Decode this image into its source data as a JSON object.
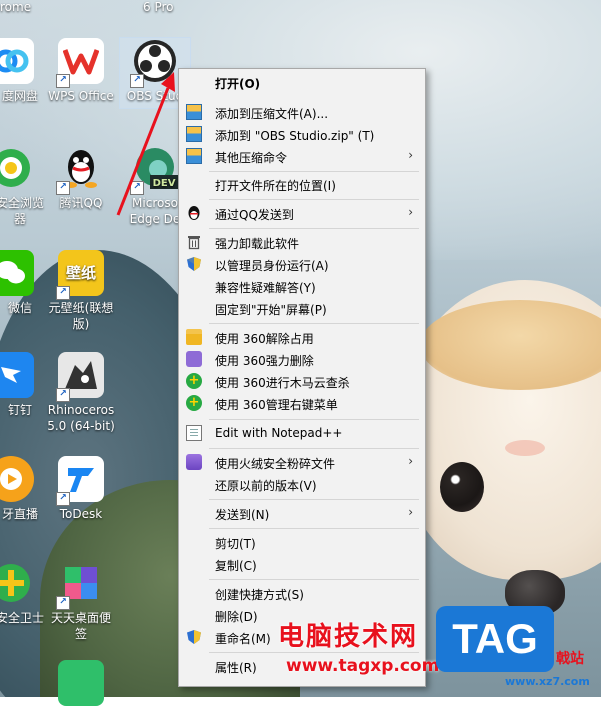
{
  "top_labels": [
    "rome",
    "6 Pro"
  ],
  "desktop_icons": [
    {
      "label": "度网盘",
      "icon": "baidu-netdisk-icon",
      "color": "#1c8cf3"
    },
    {
      "label": "WPS Office",
      "icon": "wps-office-icon",
      "color": "#e5322b"
    },
    {
      "label": "OBS Stud",
      "icon": "obs-studio-icon",
      "color": "#262626"
    },
    {
      "label": "安全浏览器",
      "icon": "360-browser-icon",
      "color": "#2fae4c"
    },
    {
      "label": "腾讯QQ",
      "icon": "qq-icon",
      "color": "#111111"
    },
    {
      "label": "Microso Edge De",
      "icon": "edge-dev-icon",
      "color": "#2a8b63"
    },
    {
      "label": "微信",
      "icon": "wechat-icon",
      "color": "#2dc100"
    },
    {
      "label": "元壁纸(联想版)",
      "icon": "wallpaper-app-icon",
      "color": "#f3c51b"
    },
    {
      "label": "钉钉",
      "icon": "dingtalk-icon",
      "color": "#1e86f0"
    },
    {
      "label": "Rhinoceros 5.0 (64-bit)",
      "icon": "rhinoceros-icon",
      "color": "#333333"
    },
    {
      "label": "牙直播",
      "icon": "huya-icon",
      "color": "#f6a21a"
    },
    {
      "label": "ToDesk",
      "icon": "todesk-icon",
      "color": "#1a86f2"
    },
    {
      "label": "安全卫士",
      "icon": "360-security-icon",
      "color": "#2fae4c"
    },
    {
      "label": "天天桌面便签",
      "icon": "desktop-notes-icon",
      "color": "#6f4fd3"
    }
  ],
  "menu_items": [
    {
      "label": "打开(O)",
      "icon": "",
      "bold": true,
      "submenu": false
    },
    {
      "label": "添加到压缩文件(A)...",
      "icon": "zip-icon",
      "submenu": false
    },
    {
      "label": "添加到 \"OBS Studio.zip\" (T)",
      "icon": "zip-icon",
      "submenu": false
    },
    {
      "label": "其他压缩命令",
      "icon": "zip-icon",
      "submenu": true
    },
    {
      "label": "打开文件所在的位置(I)",
      "icon": "",
      "submenu": false
    },
    {
      "label": "通过QQ发送到",
      "icon": "qq-icon",
      "submenu": true
    },
    {
      "label": "强力卸载此软件",
      "icon": "trash-icon",
      "submenu": false
    },
    {
      "label": "以管理员身份运行(A)",
      "icon": "uac-shield-icon",
      "submenu": false
    },
    {
      "label": "兼容性疑难解答(Y)",
      "icon": "",
      "submenu": false
    },
    {
      "label": "固定到\"开始\"屏幕(P)",
      "icon": "",
      "submenu": false
    },
    {
      "label": "使用 360解除占用",
      "icon": "360-unlock-icon",
      "submenu": false
    },
    {
      "label": "使用 360强力删除",
      "icon": "360-delete-icon",
      "submenu": false
    },
    {
      "label": "使用 360进行木马云查杀",
      "icon": "360-scan-icon",
      "submenu": false
    },
    {
      "label": "使用 360管理右键菜单",
      "icon": "360-menu-icon",
      "submenu": false
    },
    {
      "label": "Edit with Notepad++",
      "icon": "notepad-icon",
      "submenu": false
    },
    {
      "label": "使用火绒安全粉碎文件",
      "icon": "huorong-icon",
      "submenu": true
    },
    {
      "label": "还原以前的版本(V)",
      "icon": "",
      "submenu": false
    },
    {
      "label": "发送到(N)",
      "icon": "",
      "submenu": true
    },
    {
      "label": "剪切(T)",
      "icon": "",
      "submenu": false
    },
    {
      "label": "复制(C)",
      "icon": "",
      "submenu": false
    },
    {
      "label": "创建快捷方式(S)",
      "icon": "",
      "submenu": false
    },
    {
      "label": "删除(D)",
      "icon": "",
      "submenu": false
    },
    {
      "label": "重命名(M)",
      "icon": "uac-shield-icon",
      "submenu": false
    },
    {
      "label": "属性(R)",
      "icon": "",
      "submenu": false
    }
  ],
  "submenu_arrow": "›",
  "watermark": {
    "text": "电脑技术网",
    "url": "www.tagxp.com",
    "logo": "TAG",
    "logo_suffix": "戟站",
    "logo_url": "www.xz7.com"
  }
}
